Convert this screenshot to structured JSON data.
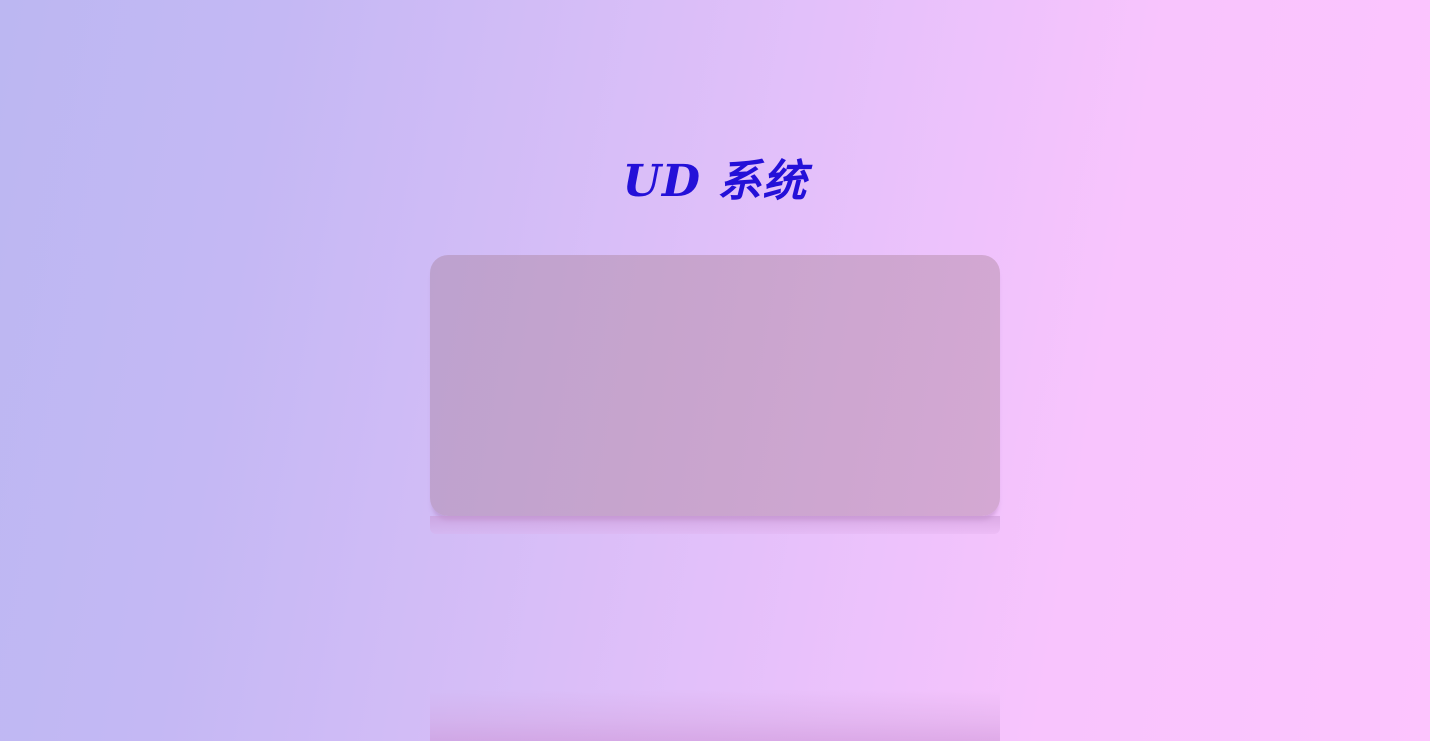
{
  "header": {
    "title": "UD 系统"
  },
  "colors": {
    "title": "#2410d8",
    "background_left": "#bcb7f2",
    "background_right": "#fdc4fe",
    "panel": "#c7a4cd"
  }
}
